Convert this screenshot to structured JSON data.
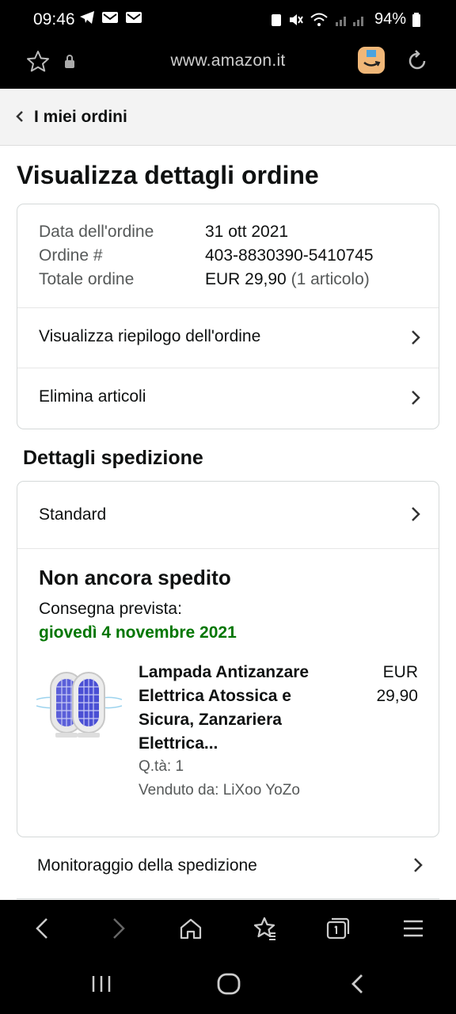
{
  "status_bar": {
    "time": "09:46",
    "battery": "94%"
  },
  "browser": {
    "url": "www.amazon.it"
  },
  "breadcrumb": {
    "label": "I miei ordini"
  },
  "page": {
    "title": "Visualizza dettagli ordine"
  },
  "order_info": {
    "date_label": "Data dell'ordine",
    "date_value": "31 ott 2021",
    "number_label": "Ordine #",
    "number_value": "403-8830390-5410745",
    "total_label": "Totale ordine",
    "total_value": "EUR 29,90",
    "total_items": "(1 articolo)"
  },
  "order_links": {
    "summary": "Visualizza riepilogo dell'ordine",
    "delete_items": "Elimina articoli"
  },
  "shipping": {
    "section_title": "Dettagli spedizione",
    "method": "Standard",
    "status": "Non ancora spedito",
    "delivery_label": "Consegna prevista:",
    "delivery_date": "giovedì 4 novembre 2021",
    "tracking_label": "Monitoraggio della spedizione"
  },
  "product": {
    "title_lines": [
      "Lampada Antizanzare",
      "Elettrica Atossica e",
      "Sicura, Zanzariera",
      "Elettrica..."
    ],
    "price_currency": "EUR",
    "price_value": "29,90",
    "quantity": "Q.tà: 1",
    "seller": "Venduto da: LiXoo YoZo"
  },
  "colors": {
    "delivery_green": "#007600",
    "border": "#d5d9d9",
    "breadcrumb_bg": "#f3f3f3"
  },
  "icons": [
    "star-icon",
    "lock-icon",
    "amazon-app-icon",
    "refresh-icon",
    "chevron-left-icon",
    "chevron-right-icon",
    "back-icon",
    "forward-icon",
    "home-icon",
    "bookmarks-icon",
    "tabs-icon",
    "menu-icon",
    "recents-icon",
    "home-nav-icon",
    "back-nav-icon"
  ]
}
